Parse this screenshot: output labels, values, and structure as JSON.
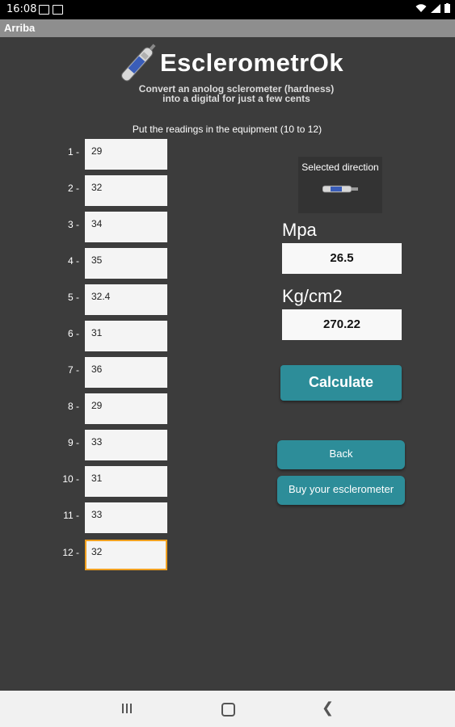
{
  "status_bar": {
    "time": "16:08"
  },
  "title_bar": {
    "title": "Arriba"
  },
  "header": {
    "app_title": "EsclerometrOk",
    "subtitle_line1": "Convert an anolog sclerometer (hardness)",
    "subtitle_line2": "into a digital for just a few cents"
  },
  "instructions": "Put the readings in the equipment (10 to 12)",
  "readings": [
    {
      "label": "1 -",
      "value": "29"
    },
    {
      "label": "2 -",
      "value": "32"
    },
    {
      "label": "3 -",
      "value": "34"
    },
    {
      "label": "4 -",
      "value": "35"
    },
    {
      "label": "5 -",
      "value": "32.4"
    },
    {
      "label": "6 -",
      "value": "31"
    },
    {
      "label": "7 -",
      "value": "36"
    },
    {
      "label": "8 -",
      "value": "29"
    },
    {
      "label": "9 -",
      "value": "33"
    },
    {
      "label": "10 -",
      "value": "31"
    },
    {
      "label": "11 -",
      "value": "33"
    },
    {
      "label": "12 -",
      "value": "32"
    }
  ],
  "direction": {
    "label": "Selected direction",
    "icon": "sclerometer-horizontal-icon"
  },
  "results": {
    "mpa_label": "Mpa",
    "mpa_value": "26.5",
    "kg_label": "Kg/cm2",
    "kg_value": "270.22"
  },
  "buttons": {
    "calculate": "Calculate",
    "back": "Back",
    "buy": "Buy your esclerometer"
  },
  "colors": {
    "accent": "#2d8d99",
    "background": "#3c3c3c",
    "focus": "#f0a020"
  }
}
